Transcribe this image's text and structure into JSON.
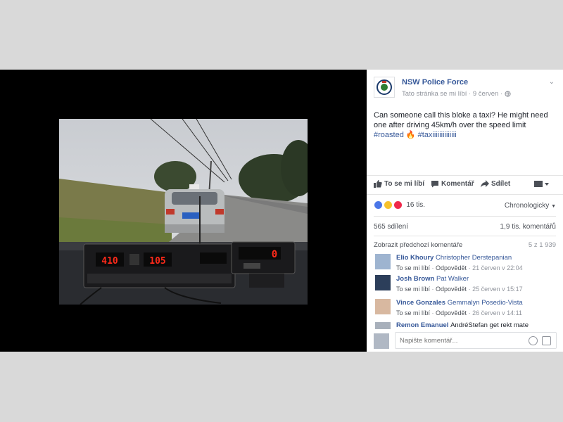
{
  "post": {
    "page_name": "NSW Police Force",
    "like_status": "Tato stránka se mi líbí",
    "date": "9 červen",
    "text_line1": "Can someone call this bloke a taxi? He might need one after driving 45km/h over the speed limit",
    "hashtag1": "#roasted",
    "emoji": "🔥",
    "hashtag2": "#taxiiiiiiiiiiiiii"
  },
  "actions": {
    "like": "To se mi líbí",
    "comment": "Komentář",
    "share": "Sdílet"
  },
  "stats": {
    "reactions_count": "16 tis.",
    "order": "Chronologicky",
    "shares": "565 sdílení",
    "comments": "1,9 tis. komentářů"
  },
  "comments_header": {
    "previous": "Zobrazit předchozí komentáře",
    "count": "5 z 1 939"
  },
  "comments": [
    {
      "name": "Elio Khoury",
      "text": "Christopher Derstepanian",
      "like": "To se mi líbí",
      "reply": "Odpovědět",
      "time": "21 červen v 22:04"
    },
    {
      "name": "Josh Brown",
      "text": "Pat Walker",
      "like": "To se mi líbí",
      "reply": "Odpovědět",
      "time": "25 červen v 15:17"
    },
    {
      "name": "Vince Gonzales",
      "text": "Gemmalyn Posedio-Vista",
      "like": "To se mi líbí",
      "reply": "Odpovědět",
      "time": "26 červen v 14:11"
    },
    {
      "name": "Remon Emanuel",
      "text": "AndréStefan get rekt mate"
    }
  ],
  "reply": {
    "placeholder": "Napište komentář..."
  },
  "radar": {
    "left_display": "410",
    "center_display": "105",
    "right_display": "0"
  },
  "colors": {
    "link": "#365899",
    "meta": "#90949c",
    "photo_bg": "#000000",
    "display_red": "#ff2a1a"
  }
}
